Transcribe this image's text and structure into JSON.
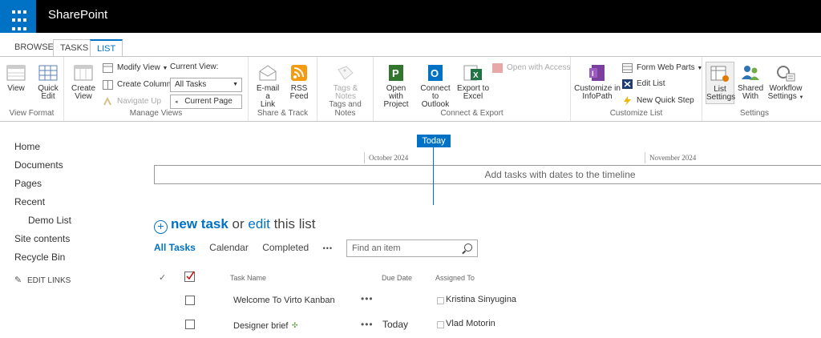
{
  "suitebar": {
    "title": "SharePoint"
  },
  "tabs": [
    "BROWSE",
    "TASKS",
    "LIST"
  ],
  "ribbon": {
    "view_format": {
      "label": "View Format",
      "view": "View",
      "quick_edit_1": "Quick",
      "quick_edit_2": "Edit"
    },
    "manage_views": {
      "label": "Manage Views",
      "create_view_1": "Create",
      "create_view_2": "View",
      "modify_view": "Modify View",
      "create_column": "Create Column",
      "navigate_up": "Navigate Up",
      "current_view_label": "Current View:",
      "current_view_value": "All Tasks",
      "current_page": "Current Page"
    },
    "share_track": {
      "label": "Share & Track",
      "email_1": "E-mail a",
      "email_2": "Link",
      "rss_1": "RSS",
      "rss_2": "Feed"
    },
    "tags_notes": {
      "label": "Tags and Notes",
      "tags_1": "Tags &",
      "tags_2": "Notes"
    },
    "connect_export": {
      "label": "Connect & Export",
      "project_1": "Open with",
      "project_2": "Project",
      "outlook_1": "Connect to",
      "outlook_2": "Outlook",
      "excel_1": "Export to",
      "excel_2": "Excel",
      "access": "Open with Access"
    },
    "customize_list": {
      "label": "Customize List",
      "infopath_1": "Customize in",
      "infopath_2": "InfoPath",
      "form_web_parts": "Form Web Parts",
      "edit_list": "Edit List",
      "new_quick_step": "New Quick Step"
    },
    "settings": {
      "label": "Settings",
      "list_settings_1": "List",
      "list_settings_2": "Settings",
      "shared_with_1": "Shared",
      "shared_with_2": "With",
      "workflow_1": "Workflow",
      "workflow_2": "Settings"
    }
  },
  "nav": {
    "items": [
      "Home",
      "Documents",
      "Pages",
      "Recent",
      "Demo List",
      "Site contents",
      "Recycle Bin"
    ],
    "edit_links": "EDIT LINKS"
  },
  "timeline": {
    "today": "Today",
    "months": [
      "October 2024",
      "November 2024"
    ],
    "empty_message": "Add tasks with dates to the timeline"
  },
  "list": {
    "new_task": "new task",
    "or": "or",
    "edit": "edit",
    "this_list": "this list",
    "views": [
      "All Tasks",
      "Calendar",
      "Completed"
    ],
    "more_views": "•••",
    "search_placeholder": "Find an item",
    "columns": {
      "task_name": "Task Name",
      "due_date": "Due Date",
      "assigned_to": "Assigned To"
    },
    "rows": [
      {
        "task": "Welcome To Virto Kanban",
        "due": "",
        "assigned": "Kristina Sinyugina"
      },
      {
        "task": "Designer brief",
        "due": "Today",
        "assigned": "Vlad Motorin"
      }
    ]
  },
  "colors": {
    "accent": "#0072c6",
    "suitebar": "#000000"
  }
}
